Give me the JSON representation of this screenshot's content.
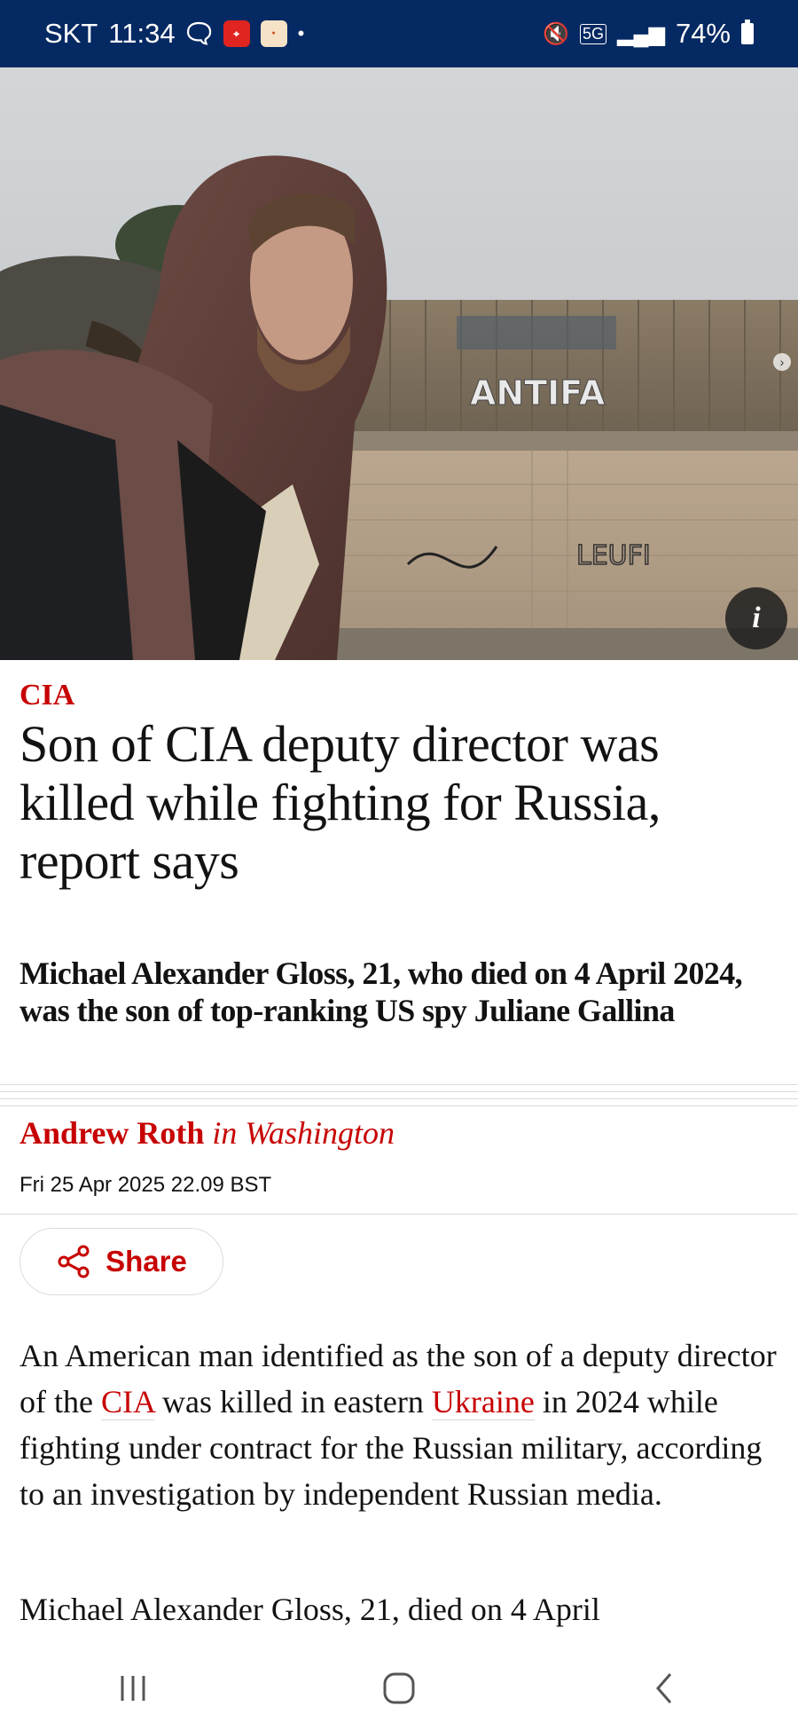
{
  "status_bar": {
    "carrier": "SKT",
    "time": "11:34",
    "network": "5G",
    "battery": "74%"
  },
  "hero": {
    "graffiti_text": "ANTIFA",
    "graffiti_text_2": "LEUFI",
    "info_label": "i"
  },
  "article": {
    "kicker": "CIA",
    "headline": "Son of CIA deputy director was killed while fighting for Russia, report says",
    "standfirst": "Michael Alexander Gloss, 21, who died on 4 April 2024, was the son of top-ranking US spy Juliane Gallina",
    "byline": {
      "author": "Andrew Roth",
      "location": "in Washington"
    },
    "dateline": "Fri 25 Apr 2025 22.09 BST",
    "share_label": "Share",
    "paragraph1": {
      "part1": "An American man identified as the son of a deputy director of the ",
      "link1": "CIA",
      "part2": " was killed in eastern ",
      "link2": "Ukraine",
      "part3": " in 2024 while fighting under contract for the Russian military, according to an investigation by independent Russian media."
    },
    "paragraph2": "Michael Alexander Gloss, 21, died on 4 April"
  },
  "colors": {
    "status_bar_bg": "#052962",
    "accent_red": "#c70000"
  },
  "icons": {
    "share": "share-icon",
    "info": "info-icon",
    "nav_recent": "recent-apps-icon",
    "nav_home": "home-icon",
    "nav_back": "back-icon"
  }
}
